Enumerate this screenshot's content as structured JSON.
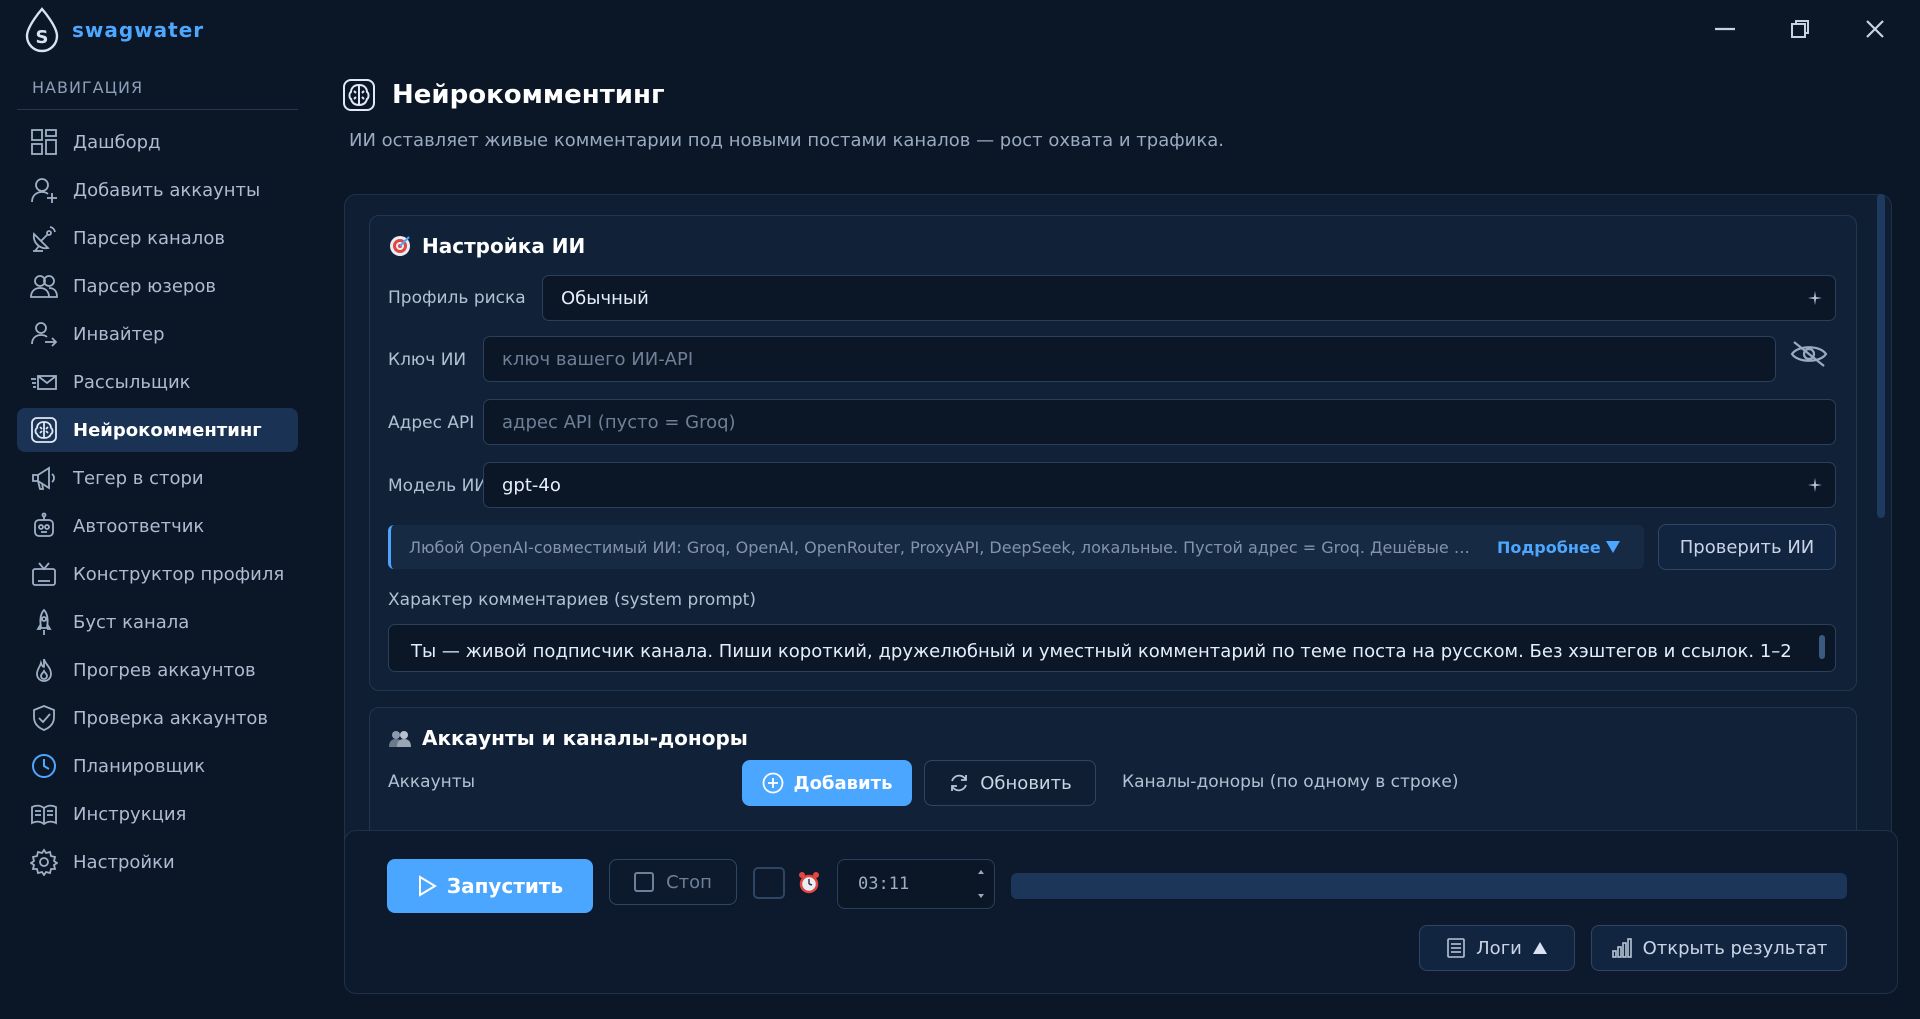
{
  "app": {
    "name": "swagwater",
    "accent": "#4ea7ff",
    "window_controls": [
      "minimize-icon",
      "restore-icon",
      "close-icon"
    ]
  },
  "sidebar": {
    "heading": "НАВИГАЦИЯ",
    "items": [
      {
        "label": "Дашборд",
        "icon": "dashboard-icon"
      },
      {
        "label": "Добавить аккаунты",
        "icon": "add-user-icon"
      },
      {
        "label": "Парсер каналов",
        "icon": "satellite-icon"
      },
      {
        "label": "Парсер юзеров",
        "icon": "users-icon"
      },
      {
        "label": "Инвайтер",
        "icon": "invite-user-icon"
      },
      {
        "label": "Рассыльщик",
        "icon": "mail-send-icon"
      },
      {
        "label": "Нейрокомментинг",
        "icon": "brain-icon",
        "active": true
      },
      {
        "label": "Тегер в стори",
        "icon": "megaphone-icon"
      },
      {
        "label": "Автоответчик",
        "icon": "robot-icon"
      },
      {
        "label": "Конструктор профиля",
        "icon": "tv-icon"
      },
      {
        "label": "Буст канала",
        "icon": "rocket-icon"
      },
      {
        "label": "Прогрев аккаунтов",
        "icon": "flame-icon"
      },
      {
        "label": "Проверка аккаунтов",
        "icon": "shield-check-icon"
      },
      {
        "label": "Планировщик",
        "icon": "clock-icon"
      },
      {
        "label": "Инструкция",
        "icon": "book-icon"
      },
      {
        "label": "Настройки",
        "icon": "gear-icon"
      }
    ]
  },
  "page": {
    "title": "Нейрокомментинг",
    "subtitle": "ИИ оставляет живые комментарии под новыми постами каналов — рост охвата и трафика."
  },
  "ai_settings": {
    "title": "Настройка ИИ",
    "risk_label": "Профиль риска",
    "risk_value": "Обычный",
    "key_label": "Ключ ИИ",
    "key_placeholder": "ключ вашего ИИ-API",
    "api_label": "Адрес API",
    "api_placeholder": "адрес API (пусто = Groq)",
    "model_label": "Модель ИИ",
    "model_value": "gpt-4o",
    "hint_text": "Любой OpenAI-совместимый ИИ: Groq, OpenAI, OpenRouter, ProxyAPI, DeepSeek, локальные. Пустой адрес = Groq. Дешёвые мод...",
    "hint_more": "Подробнее",
    "check_button": "Проверить ИИ",
    "prompt_label": "Характер комментариев (system prompt)",
    "prompt_value": "Ты — живой подписчик канала. Пиши короткий, дружелюбный и уместный комментарий по теме поста на русском. Без хэштегов и ссылок. 1–2"
  },
  "accounts": {
    "title": "Аккаунты и каналы-доноры",
    "accounts_label": "Аккаунты",
    "add_button": "Добавить",
    "refresh_button": "Обновить",
    "donors_label": "Каналы-доноры (по одному в строке)"
  },
  "controls": {
    "run_button": "Запустить",
    "stop_button": "Стоп",
    "timer_value": "03:11",
    "progress": 0,
    "logs_button": "Логи",
    "open_result_button": "Открыть результат"
  }
}
